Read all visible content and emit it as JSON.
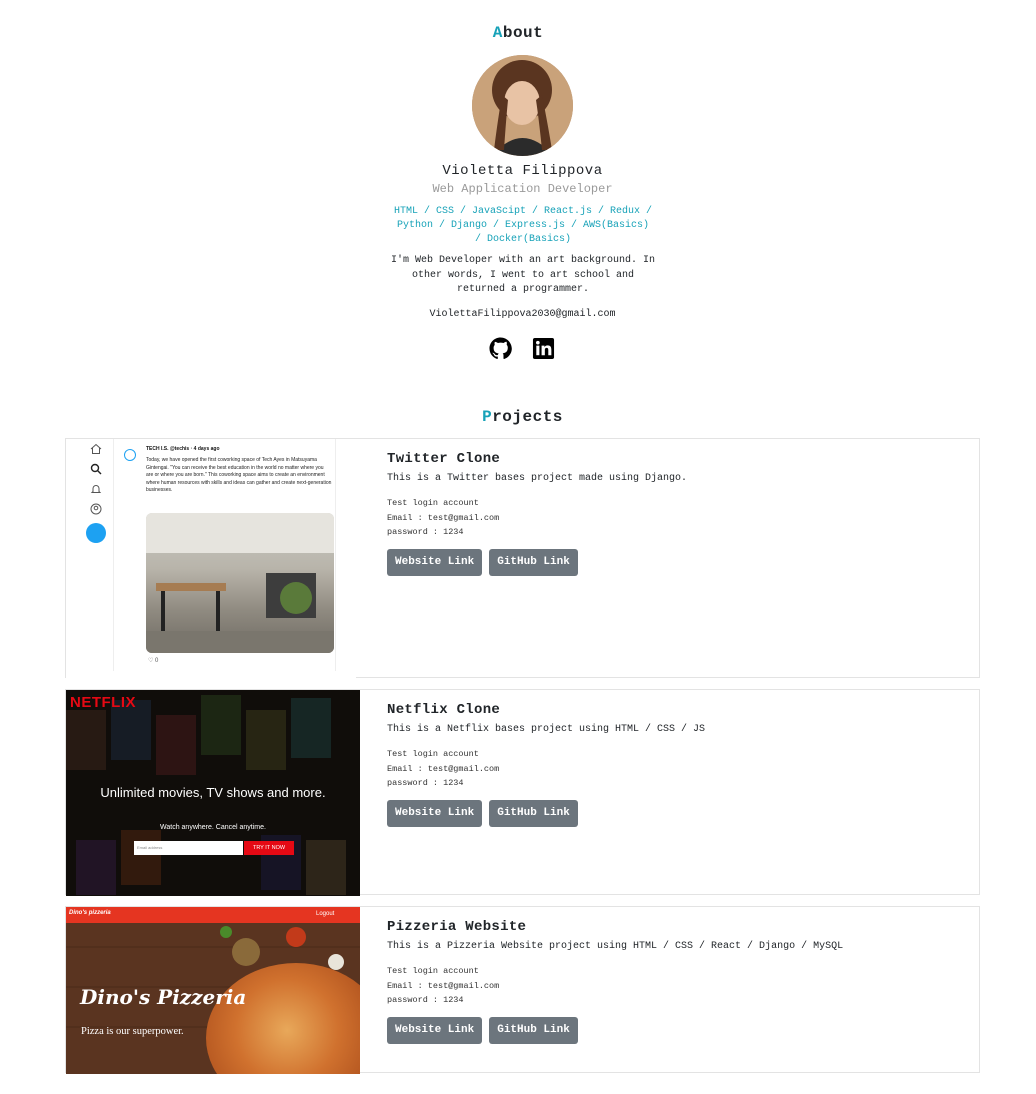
{
  "about": {
    "title_first": "A",
    "title_rest": "bout",
    "name": "Violetta Filippova",
    "role": "Web Application Developer",
    "skills": "HTML / CSS / JavaScipt / React.js / Redux / Python / Django / Express.js / AWS(Basics) / Docker(Basics)",
    "bio": "I'm Web Developer with an art background. In other words, I went to art school and returned a programmer.",
    "email": "ViolettaFilippova2030@gmail.com",
    "social": [
      {
        "icon": "github-icon"
      },
      {
        "icon": "linkedin-icon"
      }
    ]
  },
  "projects": {
    "title_first": "P",
    "title_rest": "rojects",
    "items": [
      {
        "title": "Twitter Clone",
        "desc": "This is a Twitter bases project made using Django.",
        "creds_label": "Test login account",
        "creds_email": "Email : test@gmail.com",
        "creds_password": "password : 1234",
        "website_label": "Website Link",
        "github_label": "GitHub Link",
        "preview": {
          "handle": "TECH I.S. @techis · 4 days ago",
          "text": "Today, we have opened the first coworking space of Tech Ayes in Matsuyama Gintengai. \"You can receive the best education in the world no matter where you are or where you are born.\" This coworking space aims to create an environment where human resources with skills and ideas can gather and create next-generation businesses.",
          "likes": "♡ 0"
        }
      },
      {
        "title": "Netflix Clone",
        "desc": "This is a Netflix bases project using HTML / CSS / JS",
        "creds_label": "Test login account",
        "creds_email": "Email : test@gmail.com",
        "creds_password": "password : 1234",
        "website_label": "Website Link",
        "github_label": "GitHub Link",
        "preview": {
          "logo": "NETFLIX",
          "headline": "Unlimited movies, TV shows and more.",
          "sub": "Watch anywhere. Cancel anytime.",
          "email_placeholder": "Email address",
          "cta": "TRY IT NOW"
        }
      },
      {
        "title": "Pizzeria Website",
        "desc": "This is a Pizzeria Website project using HTML / CSS / React / Django / MySQL",
        "creds_label": "Test login account",
        "creds_email": "Email : test@gmail.com",
        "creds_password": "password : 1234",
        "website_label": "Website Link",
        "github_label": "GitHub Link",
        "preview": {
          "brand": "Dino's pizzeria",
          "logout": "Logout",
          "title": "Dino's Pizzeria",
          "tagline": "Pizza is our superpower."
        }
      }
    ]
  },
  "colors": {
    "accent": "#17a2b8",
    "button": "#6c757d",
    "netflix_red": "#e50914",
    "pizza_red": "#e53521",
    "twitter_blue": "#1da1f2"
  }
}
